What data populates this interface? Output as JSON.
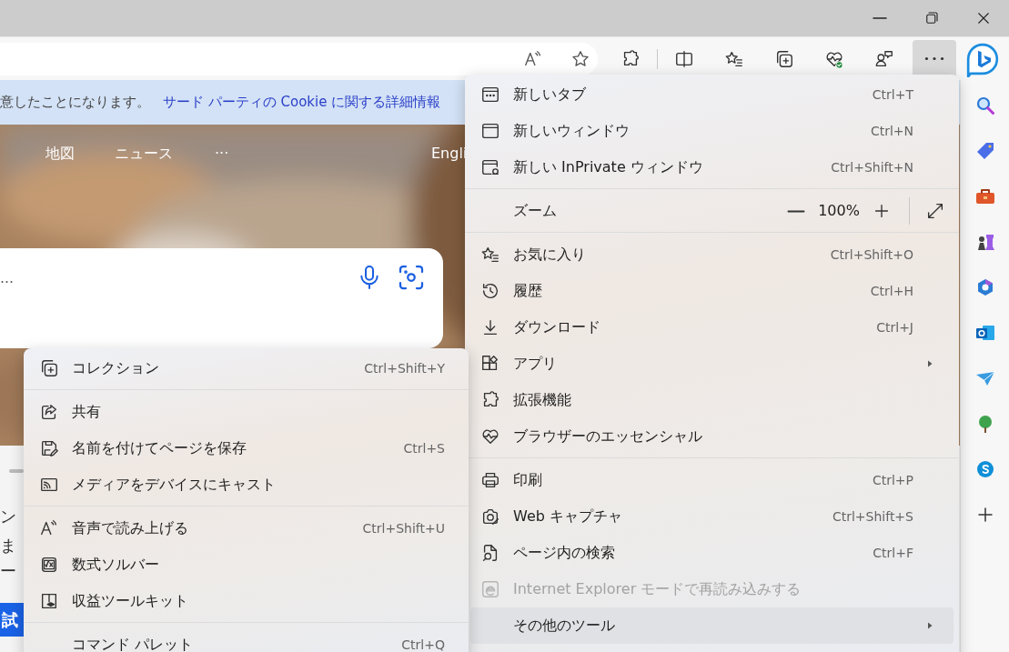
{
  "toolbar": {
    "more_button": {
      "selected": true
    }
  },
  "cookie_notice": {
    "text": "意したことになります。",
    "link": "サード パーティの Cookie に関する詳細情報"
  },
  "page_nav": {
    "items": [
      {
        "label": "地図"
      },
      {
        "label": "ニュース"
      },
      {
        "label": "···"
      }
    ],
    "language": "Engli"
  },
  "search": {
    "placeholder": "…"
  },
  "page_text": [
    "ン",
    "ま",
    "ー"
  ],
  "page_button": "試",
  "main_menu": {
    "sections": [
      [
        {
          "kind": "command",
          "label": "新しいタブ",
          "shortcut": "Ctrl+T",
          "has_submenu": false,
          "disabled": false,
          "selected": false
        },
        {
          "kind": "command",
          "label": "新しいウィンドウ",
          "shortcut": "Ctrl+N",
          "has_submenu": false,
          "disabled": false,
          "selected": false
        },
        {
          "kind": "command",
          "label": "新しい InPrivate ウィンドウ",
          "shortcut": "Ctrl+Shift+N",
          "has_submenu": false,
          "disabled": false,
          "selected": false
        }
      ],
      [
        {
          "kind": "zoom",
          "label": "ズーム",
          "value": "100%"
        }
      ],
      [
        {
          "kind": "command",
          "label": "お気に入り",
          "shortcut": "Ctrl+Shift+O",
          "has_submenu": false,
          "disabled": false,
          "selected": false
        },
        {
          "kind": "command",
          "label": "履歴",
          "shortcut": "Ctrl+H",
          "has_submenu": false,
          "disabled": false,
          "selected": false
        },
        {
          "kind": "command",
          "label": "ダウンロード",
          "shortcut": "Ctrl+J",
          "has_submenu": false,
          "disabled": false,
          "selected": false
        },
        {
          "kind": "command",
          "label": "アプリ",
          "has_submenu": true,
          "disabled": false,
          "selected": false
        },
        {
          "kind": "command",
          "label": "拡張機能",
          "has_submenu": false,
          "disabled": false,
          "selected": false
        },
        {
          "kind": "command",
          "label": "ブラウザーのエッセンシャル",
          "has_submenu": false,
          "disabled": false,
          "selected": false
        }
      ],
      [
        {
          "kind": "command",
          "label": "印刷",
          "shortcut": "Ctrl+P",
          "has_submenu": false,
          "disabled": false,
          "selected": false
        },
        {
          "kind": "command",
          "label": "Web キャプチャ",
          "shortcut": "Ctrl+Shift+S",
          "has_submenu": false,
          "disabled": false,
          "selected": false
        },
        {
          "kind": "command",
          "label": "ページ内の検索",
          "shortcut": "Ctrl+F",
          "has_submenu": false,
          "disabled": false,
          "selected": false
        },
        {
          "kind": "command",
          "label": "Internet Explorer モードで再読み込みする",
          "has_submenu": false,
          "disabled": true,
          "selected": false
        },
        {
          "kind": "command",
          "label": "その他のツール",
          "has_submenu": true,
          "disabled": false,
          "selected": true
        }
      ]
    ]
  },
  "submenu": {
    "sections": [
      [
        {
          "kind": "command",
          "label": "コレクション",
          "shortcut": "Ctrl+Shift+Y",
          "disabled": false,
          "selected": false
        }
      ],
      [
        {
          "kind": "command",
          "label": "共有",
          "disabled": false,
          "selected": false
        },
        {
          "kind": "command",
          "label": "名前を付けてページを保存",
          "shortcut": "Ctrl+S",
          "disabled": false,
          "selected": false
        },
        {
          "kind": "command",
          "label": "メディアをデバイスにキャスト",
          "disabled": false,
          "selected": false
        }
      ],
      [
        {
          "kind": "command",
          "label": "音声で読み上げる",
          "shortcut": "Ctrl+Shift+U",
          "disabled": false,
          "selected": false
        },
        {
          "kind": "command",
          "label": "数式ソルバー",
          "disabled": false,
          "selected": false
        },
        {
          "kind": "command",
          "label": "収益ツールキット",
          "disabled": false,
          "selected": false
        }
      ],
      [
        {
          "kind": "command",
          "label": "コマンド パレット",
          "shortcut": "Ctrl+Q",
          "disabled": false,
          "selected": false
        }
      ]
    ]
  }
}
